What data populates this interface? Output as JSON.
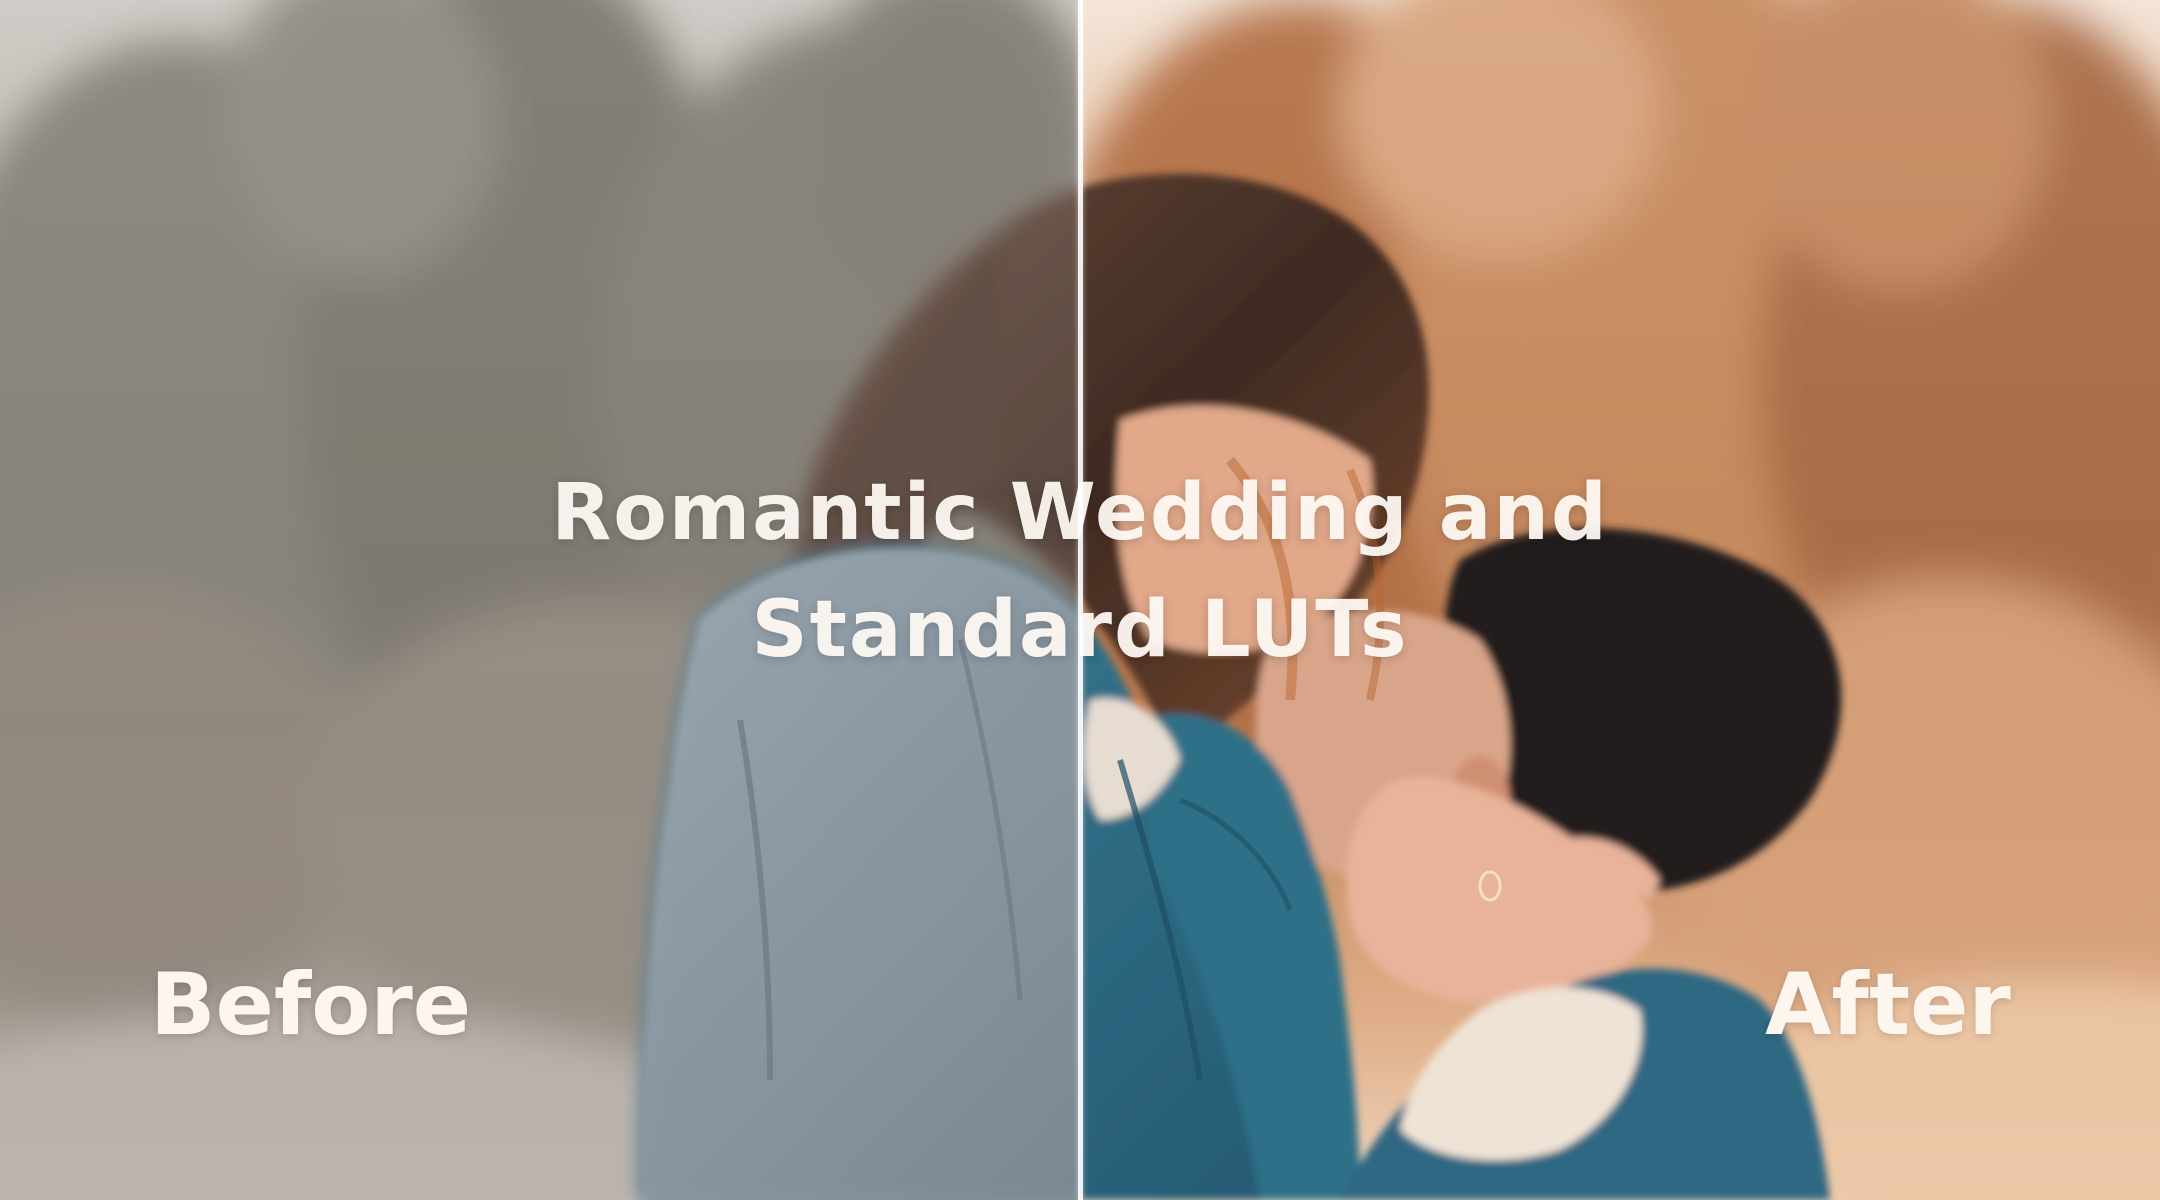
{
  "title": {
    "line1": "Romantic Wedding and",
    "line2": "Standard LUTs"
  },
  "labels": {
    "before": "Before",
    "after": "After"
  },
  "colors": {
    "before_tone": "#9a9088",
    "after_tone": "#d39a72",
    "jacket_before": "#8f9aa6",
    "jacket_after": "#3f7f98",
    "divider": "#ffffff",
    "text": "#fdf6ef"
  }
}
